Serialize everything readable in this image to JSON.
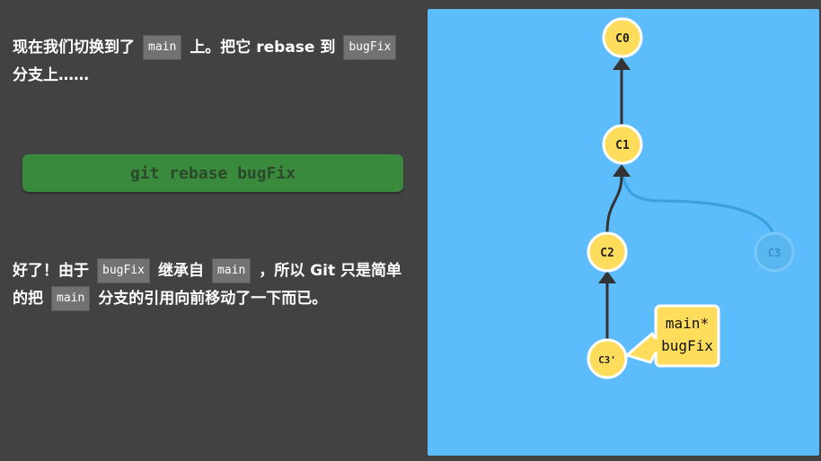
{
  "explanation": {
    "para1": [
      {
        "text": "现在我们切换到了",
        "kind": "text"
      },
      {
        "text": "main",
        "kind": "code"
      },
      {
        "text": "上。把它 ",
        "kind": "text"
      },
      {
        "text": "rebase",
        "kind": "bold"
      },
      {
        "text": " 到",
        "kind": "text"
      },
      {
        "text": "bugFix",
        "kind": "code"
      },
      {
        "text": "分支上……",
        "kind": "text"
      }
    ],
    "command": "git rebase bugFix",
    "para2": [
      {
        "text": "好了！由于",
        "kind": "text"
      },
      {
        "text": "bugFix",
        "kind": "code"
      },
      {
        "text": "继承自",
        "kind": "text"
      },
      {
        "text": "main",
        "kind": "code"
      },
      {
        "text": "，所以 ",
        "kind": "text"
      },
      {
        "text": "Git",
        "kind": "bold"
      },
      {
        "text": " 只是简单的把",
        "kind": "text"
      },
      {
        "text": "main",
        "kind": "code"
      },
      {
        "text": "分支的引用向前移动了一下而已。",
        "kind": "text"
      }
    ]
  },
  "graph": {
    "background": "#5cbcfc",
    "commit_color": "#ffdd5c",
    "commit_stroke": "#ffffff",
    "edge_color": "#333333",
    "commits": [
      {
        "id": "c0",
        "label": "C0",
        "faded": false
      },
      {
        "id": "c1",
        "label": "C1",
        "faded": false
      },
      {
        "id": "c2",
        "label": "C2",
        "faded": false
      },
      {
        "id": "c3",
        "label": "C3",
        "faded": true
      },
      {
        "id": "c3p",
        "label": "C3'",
        "faded": false
      }
    ],
    "branch_tag": {
      "lines": [
        "main*",
        "bugFix"
      ]
    }
  }
}
